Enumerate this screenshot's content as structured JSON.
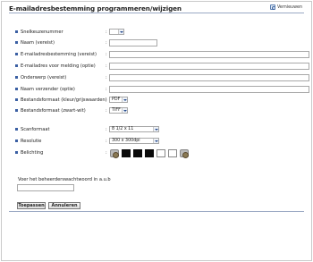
{
  "header": {
    "title": "E-mailadresbestemming programmeren/wijzigen",
    "refresh_label": "Vernieuwen"
  },
  "form": {
    "rows": [
      {
        "label": "Snelkeuzenummer",
        "control": "select",
        "value": ""
      },
      {
        "label": "Naam (vereist)",
        "control": "input",
        "value": ""
      },
      {
        "label": "E-mailadresbestemming (vereist)",
        "control": "input",
        "value": ""
      },
      {
        "label": "E-mailadres voor melding (optie)",
        "control": "input",
        "value": ""
      },
      {
        "label": "Onderwerp (vereist)",
        "control": "input",
        "value": ""
      },
      {
        "label": "Naam verzender (optie)",
        "control": "input",
        "value": ""
      },
      {
        "label": "Bestandsformaat (kleur/grijswaarden)",
        "control": "select",
        "value": "PDF"
      },
      {
        "label": "Bestandsformaat (zwart-wit)",
        "control": "select",
        "value": "TIFF"
      },
      {
        "label": "Scanformaat",
        "control": "select",
        "value": "8 1/2 x 11"
      },
      {
        "label": "Resolutie",
        "control": "select",
        "value": "300 x 300dpi"
      },
      {
        "label": "Belichting",
        "control": "swatches",
        "value": ""
      }
    ],
    "password_label": "Voer het beheerderswachtwoord in a.u.b"
  },
  "buttons": {
    "apply": "Toepassen",
    "cancel": "Annuleren"
  },
  "colors": {
    "bullet": "#3a5fa3",
    "rule": "#9aa9c4"
  }
}
